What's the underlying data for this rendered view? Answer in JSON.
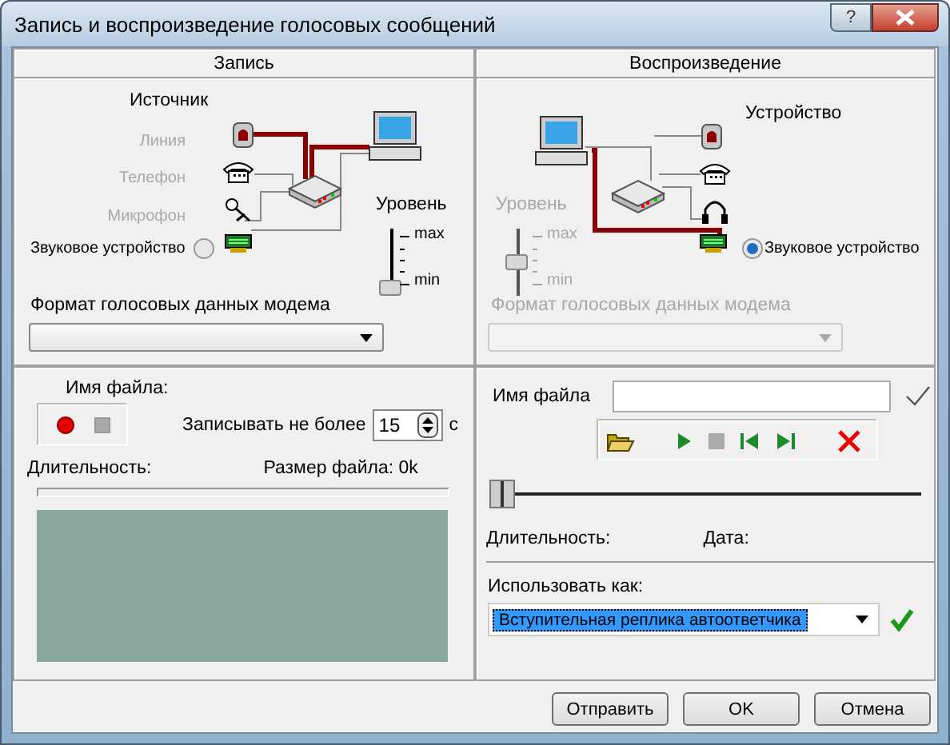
{
  "window": {
    "title": "Запись и воспроизведение голосовых сообщений",
    "help_button": "?"
  },
  "record": {
    "tab": "Запись",
    "source_title": "Источник",
    "sources": [
      {
        "label": "Линия",
        "disabled": true
      },
      {
        "label": "Телефон",
        "disabled": true
      },
      {
        "label": "Микрофон",
        "disabled": true
      }
    ],
    "sound_device": {
      "label": "Звуковое устройство",
      "selected": false
    },
    "level_title": "Уровень",
    "level_max": "max",
    "level_min": "min",
    "level": 0,
    "format_label": "Формат голосовых данных модема",
    "file_label": "Имя файла:",
    "limit_label": "Записывать не более",
    "limit_value": "15",
    "limit_unit": "с",
    "duration_label": "Длительность:",
    "size_label": "Размер файла: 0k",
    "progress": {
      "level": 0
    }
  },
  "playback": {
    "tab": "Воспроизведение",
    "device_title": "Устройство",
    "sound_device": {
      "label": "Звуковое устройство",
      "selected": true
    },
    "level_title": "Уровень",
    "level_max": "max",
    "level_min": "min",
    "level": 0.5,
    "level_disabled": true,
    "format_label": "Формат голосовых данных модема",
    "format_disabled": true,
    "file_label": "Имя файла",
    "position": {
      "level": 0
    },
    "duration_label": "Длительность:",
    "date_label": "Дата:",
    "use_as_label": "Использовать как:",
    "use_as_value": "Вступительная реплика автоответчика"
  },
  "buttons": [
    {
      "label": "Отправить"
    },
    {
      "label": "OK"
    },
    {
      "label": "Отмена"
    }
  ]
}
